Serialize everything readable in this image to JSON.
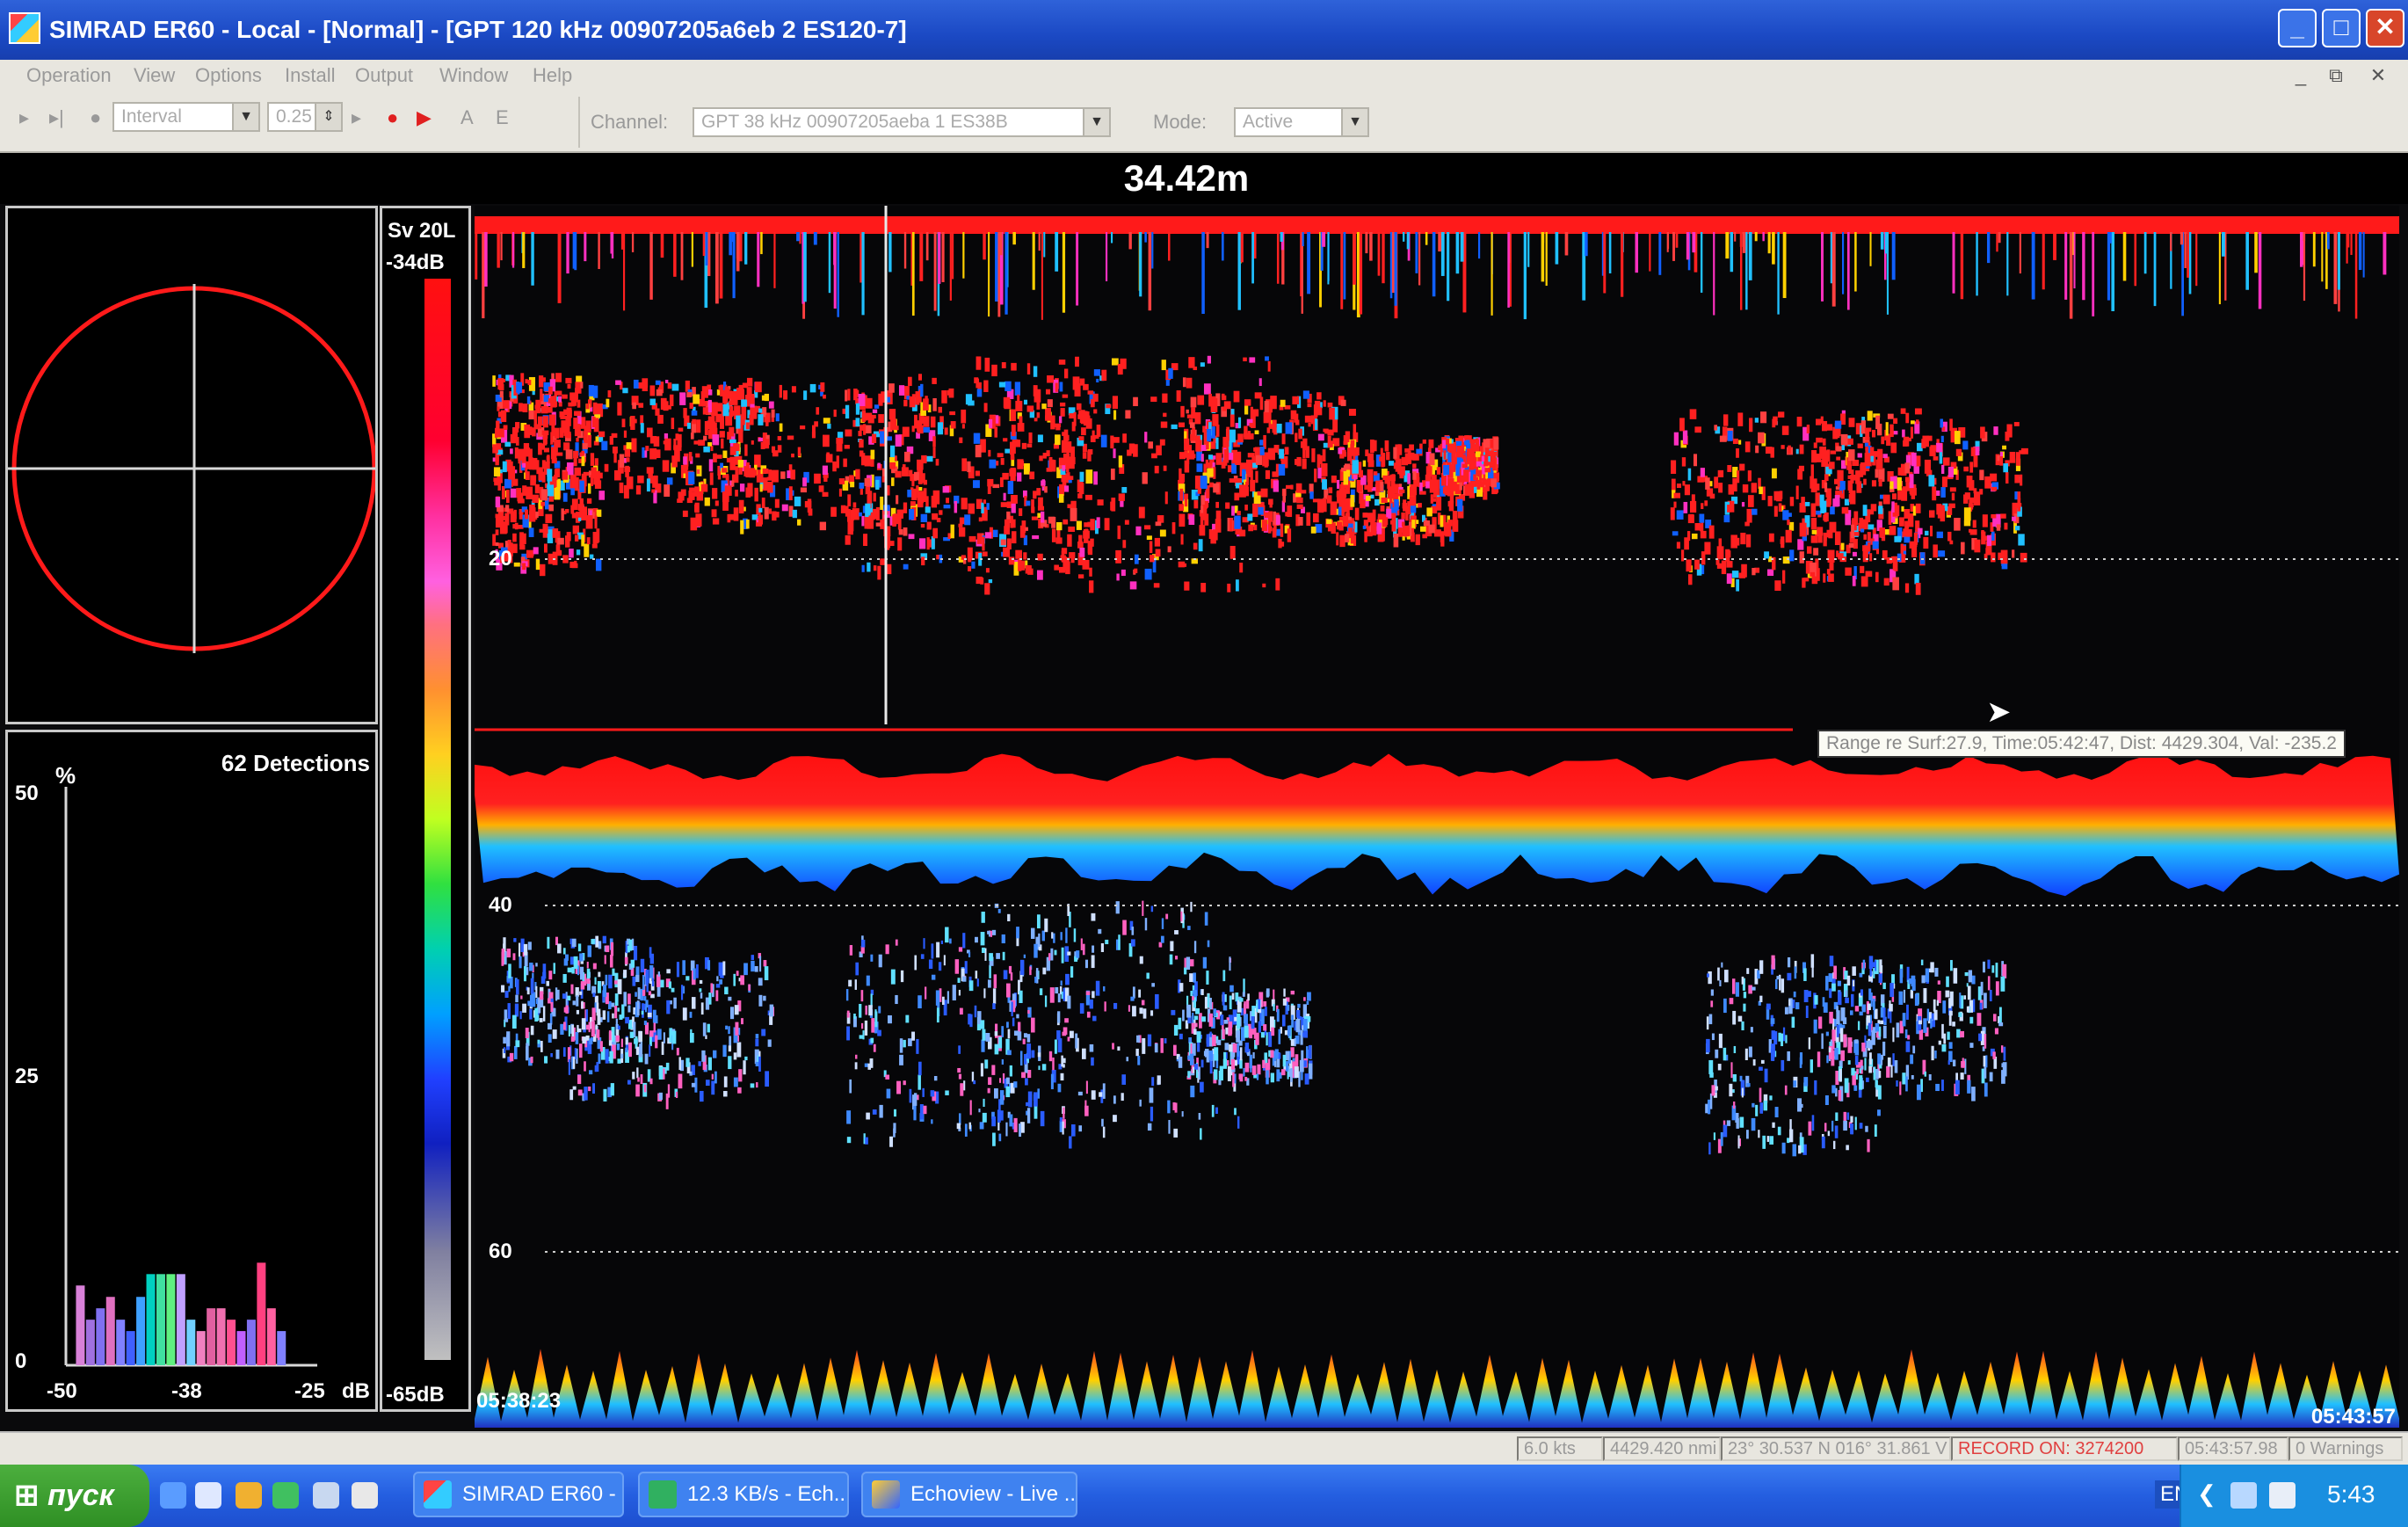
{
  "window": {
    "title": "SIMRAD ER60 - Local - [Normal] - [GPT 120 kHz 00907205a6eb 2 ES120-7]",
    "buttons": {
      "minimize": "_",
      "maximize": "□",
      "close": "✕"
    }
  },
  "menu": {
    "items": [
      "Operation",
      "View",
      "Options",
      "Install",
      "Output",
      "Window",
      "Help"
    ],
    "mdi_buttons": [
      "_",
      "⧉",
      "✕"
    ]
  },
  "toolbar": {
    "ping_mode": "Interval",
    "interval_value": "0.25",
    "record_labels": [
      "A",
      "E"
    ],
    "channel_label": "Channel:",
    "channel_value": "GPT 38 kHz 00907205aeba 1 ES38B",
    "mode_label": "Mode:",
    "mode_value": "Active"
  },
  "header": {
    "depth_readout": "34.42m"
  },
  "split_beam": {},
  "histogram": {
    "detections": "62 Detections",
    "y_unit": "%",
    "y_ticks": [
      "50",
      "25",
      "0"
    ],
    "x_ticks": [
      "-50",
      "-38",
      "-25"
    ],
    "x_unit": "dB",
    "bins": [
      {
        "x": -49,
        "pct": 7,
        "color": "#d880d8"
      },
      {
        "x": -48,
        "pct": 4,
        "color": "#a070e0"
      },
      {
        "x": -47,
        "pct": 5,
        "color": "#8070f0"
      },
      {
        "x": -46,
        "pct": 6,
        "color": "#e070c0"
      },
      {
        "x": -45,
        "pct": 4,
        "color": "#8080ff"
      },
      {
        "x": -44,
        "pct": 3,
        "color": "#4060ff"
      },
      {
        "x": -43,
        "pct": 6,
        "color": "#3fa0ff"
      },
      {
        "x": -42,
        "pct": 8,
        "color": "#00d0c0"
      },
      {
        "x": -41,
        "pct": 8,
        "color": "#40e0a0"
      },
      {
        "x": -40,
        "pct": 8,
        "color": "#60f080"
      },
      {
        "x": -39,
        "pct": 8,
        "color": "#c0a0ff"
      },
      {
        "x": -38,
        "pct": 4,
        "color": "#70d0ff"
      },
      {
        "x": -37,
        "pct": 3,
        "color": "#f080c0"
      },
      {
        "x": -36,
        "pct": 5,
        "color": "#e060a0"
      },
      {
        "x": -35,
        "pct": 5,
        "color": "#f070b0"
      },
      {
        "x": -34,
        "pct": 4,
        "color": "#ff5090"
      },
      {
        "x": -33,
        "pct": 3,
        "color": "#c060ff"
      },
      {
        "x": -32,
        "pct": 4,
        "color": "#8070f0"
      },
      {
        "x": -31,
        "pct": 9,
        "color": "#ff4080"
      },
      {
        "x": -30,
        "pct": 5,
        "color": "#ff60a0"
      },
      {
        "x": -29,
        "pct": 3,
        "color": "#8080ff"
      }
    ]
  },
  "colorbar": {
    "title": "Sv 20L",
    "max_label": "-34dB",
    "min_label": "-65dB"
  },
  "echogram": {
    "start_time": "05:38:23",
    "end_time": "05:43:57",
    "depth_ticks": [
      "20",
      "40",
      "60"
    ],
    "tooltip": "Range re Surf:27.9, Time:05:42:47, Dist: 4429.304, Val: -235.2",
    "colors": {
      "strong": "#ff2020",
      "mid": "#ffd000",
      "weak": "#1060ff"
    }
  },
  "status": {
    "speed": "6.0 kts",
    "distance": "4429.420 nmi",
    "position": "23° 30.537 N  016° 31.861 V",
    "record": "RECORD ON: 3274200",
    "time": "05:43:57.98",
    "warnings": "0 Warnings"
  },
  "taskbar": {
    "start_label": "пуск",
    "tasks": [
      "SIMRAD ER60 - ...",
      "12.3 KB/s - Ech...",
      "Echoview - Live ..."
    ],
    "language": "EN",
    "clock": "5:43"
  }
}
